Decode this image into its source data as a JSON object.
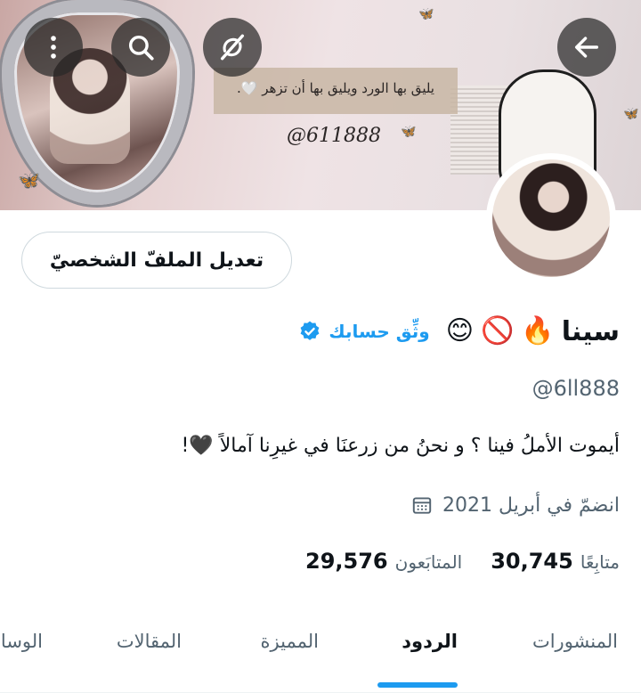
{
  "banner": {
    "quote": "يليق بها الورد ويليق بها أن تزهر 🤍.",
    "handle_text": "@611888"
  },
  "top_bar": {
    "buttons": [
      "back-arrow-icon",
      "more-vertical-icon",
      "search-icon",
      "no-sync-icon"
    ]
  },
  "profile": {
    "edit_button_label": "تعديل الملفّ الشخصيّ",
    "display_name": "سينا",
    "name_emojis": [
      "🔥",
      "🚫",
      "😊"
    ],
    "verify_label": "وثِّق حسابك",
    "handle": "@6ll888",
    "bio": "أيموت الأملُ فينا ؟ و نحنُ من زرعنَا في غيرِنا آمالاً 🖤!",
    "joined": "انضمّ في أبريل 2021"
  },
  "stats": {
    "following_count": "29,576",
    "following_label": "المتابَعون",
    "followers_count": "30,745",
    "followers_label": "متابِعًا"
  },
  "tabs": [
    {
      "label": "المنشورات",
      "active": false
    },
    {
      "label": "الردود",
      "active": true
    },
    {
      "label": "المميزة",
      "active": false
    },
    {
      "label": "المقالات",
      "active": false
    },
    {
      "label": "الوسائط",
      "active": false
    }
  ],
  "colors": {
    "accent": "#1d9bf0",
    "text_primary": "#0f1419",
    "text_secondary": "#536471",
    "border": "#cfd9de"
  }
}
